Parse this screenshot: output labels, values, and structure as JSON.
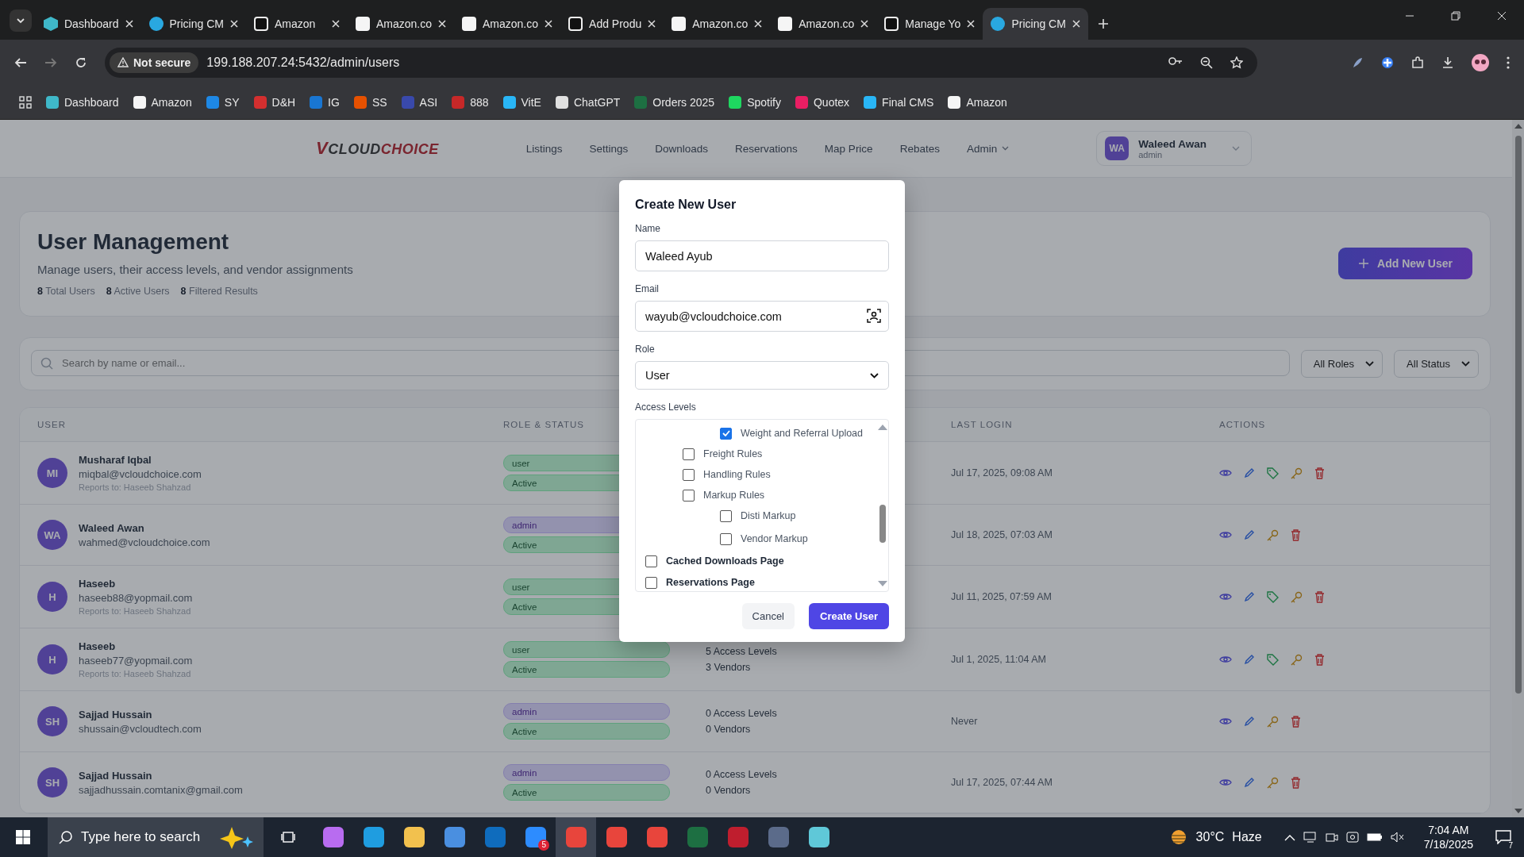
{
  "browser": {
    "tabs": [
      {
        "title": "Dashboard",
        "kind": "hex",
        "selected": false
      },
      {
        "title": "Pricing CM",
        "kind": "dollar",
        "selected": false
      },
      {
        "title": "Amazon",
        "kind": "amazon-dark",
        "selected": false
      },
      {
        "title": "Amazon.co",
        "kind": "amazon-light",
        "selected": false
      },
      {
        "title": "Amazon.co",
        "kind": "amazon-light",
        "selected": false
      },
      {
        "title": "Add Produ",
        "kind": "amazon-dark",
        "selected": false
      },
      {
        "title": "Amazon.co",
        "kind": "amazon-light",
        "selected": false
      },
      {
        "title": "Amazon.co",
        "kind": "amazon-light",
        "selected": false
      },
      {
        "title": "Manage Yo",
        "kind": "amazon-dark",
        "selected": false
      },
      {
        "title": "Pricing CM",
        "kind": "dollar",
        "selected": true
      }
    ],
    "address": {
      "security": "Not secure",
      "url": "199.188.207.24:5432/admin/users"
    },
    "bookmarks": [
      {
        "label": "Dashboard",
        "color": "#3fb8c9"
      },
      {
        "label": "Amazon",
        "color": "#f5f5f5"
      },
      {
        "label": "SY",
        "color": "#1e88e5"
      },
      {
        "label": "D&H",
        "color": "#d32f2f"
      },
      {
        "label": "IG",
        "color": "#1976d2"
      },
      {
        "label": "SS",
        "color": "#e65100"
      },
      {
        "label": "ASI",
        "color": "#3949ab"
      },
      {
        "label": "888",
        "color": "#c62828"
      },
      {
        "label": "VitE",
        "color": "#29b6f6"
      },
      {
        "label": "ChatGPT",
        "color": "#e0e0e0"
      },
      {
        "label": "Orders 2025",
        "color": "#1d6f42"
      },
      {
        "label": "Spotify",
        "color": "#1ed760"
      },
      {
        "label": "Quotex",
        "color": "#e91e63"
      },
      {
        "label": "Final CMS",
        "color": "#29b6f6"
      },
      {
        "label": "Amazon",
        "color": "#f5f5f5"
      }
    ]
  },
  "app": {
    "logo": {
      "mark": "V",
      "first": "CLOUD",
      "second": "CHOICE"
    },
    "nav": [
      {
        "label": "Listings",
        "dropdown": false
      },
      {
        "label": "Settings",
        "dropdown": false
      },
      {
        "label": "Downloads",
        "dropdown": false
      },
      {
        "label": "Reservations",
        "dropdown": false
      },
      {
        "label": "Map Price",
        "dropdown": false
      },
      {
        "label": "Rebates",
        "dropdown": false
      },
      {
        "label": "Admin",
        "dropdown": true
      }
    ],
    "user": {
      "initials": "WA",
      "name": "Waleed Awan",
      "role": "admin"
    }
  },
  "page": {
    "title": "User Management",
    "subtitle": "Manage users, their access levels, and vendor assignments",
    "stats": [
      "**8** Total Users",
      "**8** Active Users",
      "**8** Filtered Results"
    ],
    "add_button": "Add New User",
    "search": {
      "placeholder": "Search by name or email..."
    },
    "filters": [
      "All Roles",
      "All Status"
    ]
  },
  "table": {
    "columns": {
      "user": "USER",
      "role_status": "ROLE & STATUS",
      "last_login": "LAST LOGIN",
      "actions": "ACTIONS"
    },
    "rows": [
      {
        "initials": "MI",
        "name": "Musharaf Iqbal",
        "email": "miqbal@vcloudchoice.com",
        "reports_to": "Reports to: Haseeb Shahzad",
        "role": {
          "label": "user",
          "kind": "user"
        },
        "status": {
          "label": "Active",
          "active": true
        },
        "last_login": "Jul 17, 2025, 09:08 AM",
        "vendor_action": true
      },
      {
        "initials": "WA",
        "name": "Waleed Awan",
        "email": "wahmed@vcloudchoice.com",
        "role": {
          "label": "admin",
          "kind": "admin"
        },
        "status": {
          "label": "Active",
          "active": true
        },
        "last_login": "Jul 18, 2025, 07:03 AM",
        "vendor_action": false
      },
      {
        "initials": "H",
        "name": "Haseeb",
        "email": "haseeb88@yopmail.com",
        "reports_to": "Reports to: Haseeb Shahzad",
        "role": {
          "label": "user",
          "kind": "user"
        },
        "status": {
          "label": "Active",
          "active": true
        },
        "last_login": "Jul 11, 2025, 07:59 AM",
        "vendor_action": true
      },
      {
        "initials": "H",
        "name": "Haseeb",
        "email": "haseeb77@yopmail.com",
        "reports_to": "Reports to: Haseeb Shahzad",
        "role": {
          "label": "user",
          "kind": "user"
        },
        "status": {
          "label": "Active",
          "active": true
        },
        "access_levels": "5 Access Levels",
        "vendors": "3 Vendors",
        "last_login": "Jul 1, 2025, 11:04 AM",
        "vendor_action": true
      },
      {
        "initials": "SH",
        "name": "Sajjad Hussain",
        "email": "shussain@vcloudtech.com",
        "role": {
          "label": "admin",
          "kind": "admin"
        },
        "status": {
          "label": "Active",
          "active": true
        },
        "access_levels": "0 Access Levels",
        "vendors": "0 Vendors",
        "last_login": "Never",
        "vendor_action": false
      },
      {
        "initials": "SH",
        "name": "Sajjad Hussain",
        "email": "sajjadhussain.comtanix@gmail.com",
        "role": {
          "label": "admin",
          "kind": "admin"
        },
        "status": {
          "label": "Active",
          "active": true
        },
        "access_levels": "0 Access Levels",
        "vendors": "0 Vendors",
        "last_login": "Jul 17, 2025, 07:44 AM",
        "vendor_action": false
      }
    ]
  },
  "modal": {
    "title": "Create New User",
    "name": {
      "label": "Name",
      "value": "Waleed Ayub"
    },
    "email": {
      "label": "Email",
      "value": "wayub@vcloudchoice.com"
    },
    "role": {
      "label": "Role",
      "value": "User"
    },
    "access": {
      "label": "Access Levels",
      "items": [
        {
          "children": [
            {
              "children": [
                {
                  "label": "Weight and Referral Upload",
                  "checked": true
                }
              ]
            },
            {
              "label": "Freight Rules",
              "checked": false
            },
            {
              "label": "Handling Rules",
              "checked": false
            },
            {
              "label": "Markup Rules",
              "checked": false,
              "children": [
                {
                  "label": "Disti Markup",
                  "checked": false
                },
                {
                  "label": "Vendor Markup",
                  "checked": false
                }
              ]
            }
          ]
        },
        {
          "label": "Cached Downloads Page",
          "checked": false
        },
        {
          "label": "Reservations Page",
          "checked": false
        }
      ]
    },
    "cancel": "Cancel",
    "submit": "Create User"
  },
  "taskbar": {
    "search": {
      "placeholder": "Type here to search"
    },
    "apps": [
      {
        "color": "#b86cf0",
        "selected": false
      },
      {
        "color": "#1f9de0",
        "selected": false
      },
      {
        "color": "#f2c14e",
        "selected": false
      },
      {
        "color": "#4a8fe0",
        "selected": false
      },
      {
        "color": "#0f6cbd",
        "selected": false
      },
      {
        "color": "#2d8cff",
        "selected": false,
        "badge": "5"
      },
      {
        "color": "#e8453c",
        "selected": true
      },
      {
        "color": "#e8453c",
        "selected": false
      },
      {
        "color": "#e8453c",
        "selected": false
      },
      {
        "color": "#1d6f42",
        "selected": false
      },
      {
        "color": "#bf1e2e",
        "selected": false
      },
      {
        "color": "#5b6b8a",
        "selected": false
      },
      {
        "color": "#5fc8d8",
        "selected": false
      }
    ],
    "weather": {
      "temp": "30°C",
      "condition": "Haze"
    },
    "time": "7:04 AM",
    "date": "7/18/2025",
    "notifications": "7"
  }
}
